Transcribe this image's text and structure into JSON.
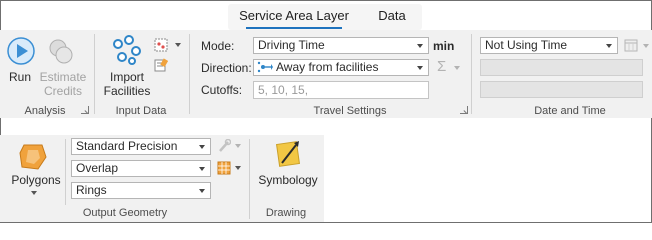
{
  "tabs": [
    {
      "label": "Service Area Layer",
      "active": true
    },
    {
      "label": "Data",
      "active": false
    }
  ],
  "analysis": {
    "run_label": "Run",
    "estimate_credits_label_1": "Estimate",
    "estimate_credits_label_2": "Credits",
    "group_label": "Analysis"
  },
  "input_data": {
    "import_label_1": "Import",
    "import_label_2": "Facilities",
    "group_label": "Input Data"
  },
  "travel_settings": {
    "mode_label": "Mode:",
    "mode_value": "Driving Time",
    "mode_unit": "min",
    "direction_label": "Direction:",
    "direction_value": "Away from facilities",
    "cutoffs_label": "Cutoffs:",
    "cutoffs_placeholder": "5, 10, 15,",
    "group_label": "Travel Settings"
  },
  "date_time": {
    "time_value": "Not Using Time",
    "group_label": "Date and Time"
  },
  "output_geometry": {
    "polygons_label": "Polygons",
    "precision_value": "Standard Precision",
    "overlap_value": "Overlap",
    "rings_value": "Rings",
    "group_label": "Output Geometry"
  },
  "drawing": {
    "symbology_label": "Symbology",
    "group_label": "Drawing"
  },
  "colors": {
    "accent": "#1e73be",
    "run_icon": "#3b8fd4",
    "facilities_icon": "#2f86c8",
    "polygons_icon": "#f0a23c",
    "symbology_icon": "#f2c744"
  }
}
